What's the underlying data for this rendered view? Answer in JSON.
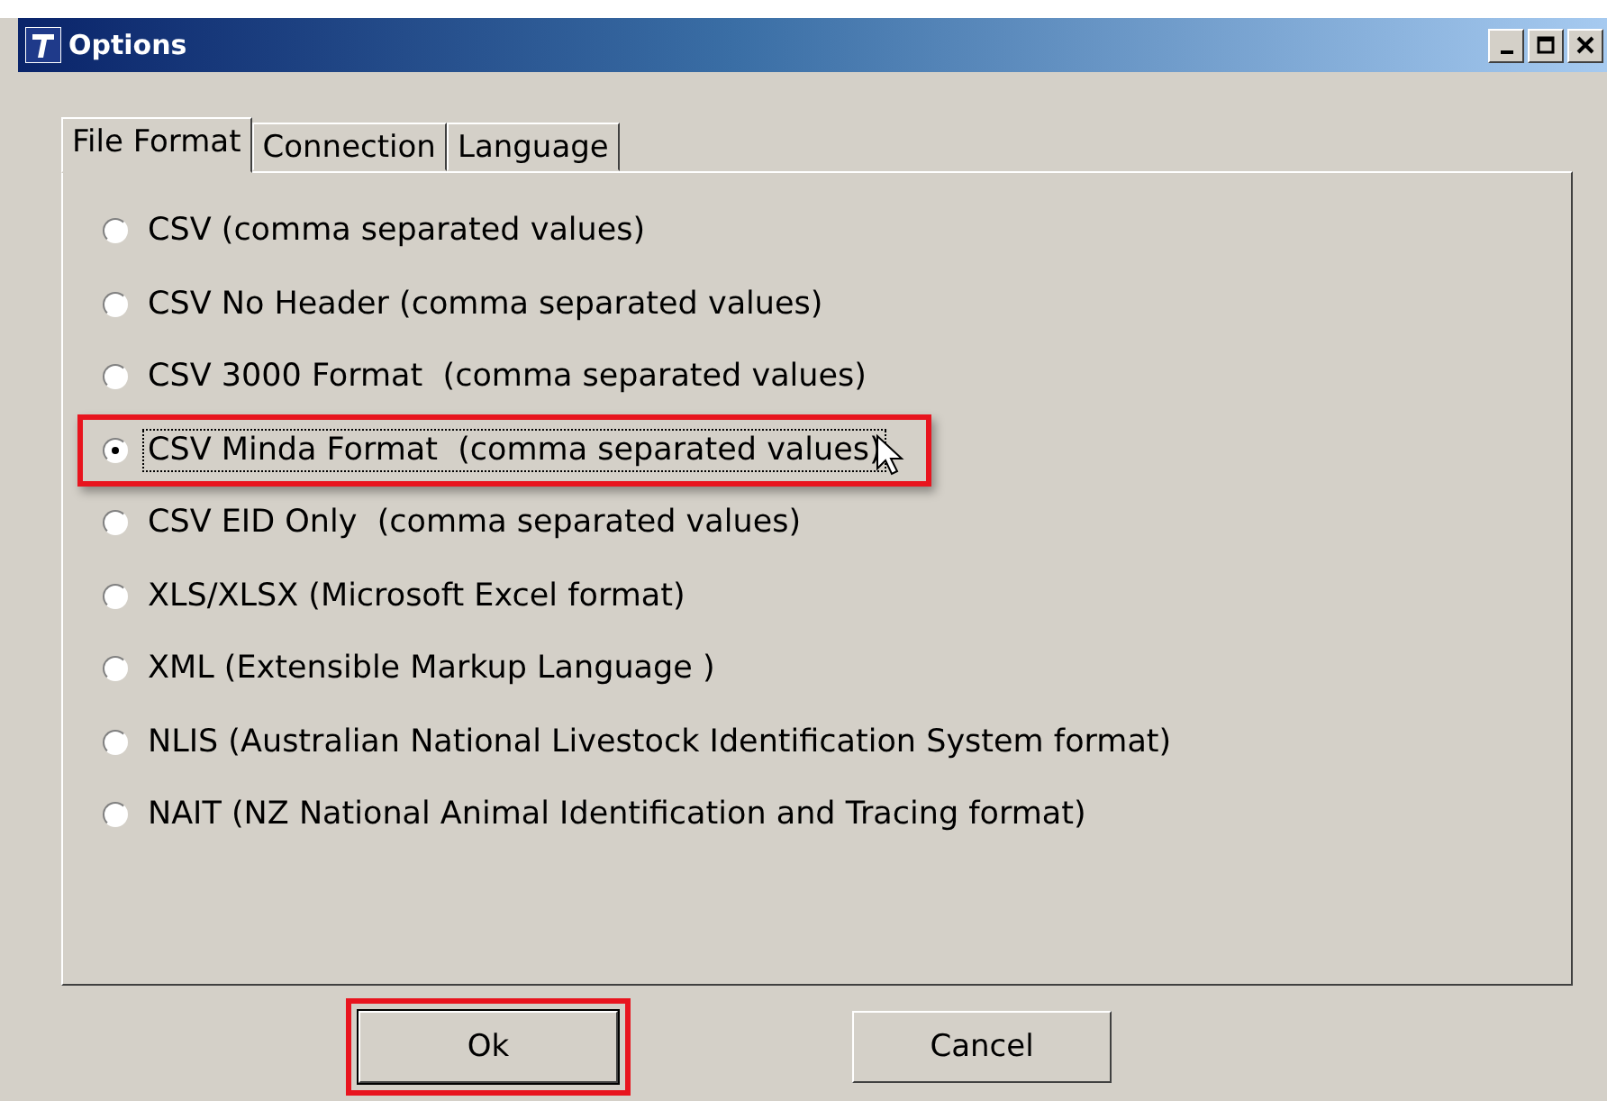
{
  "window": {
    "title": "Options"
  },
  "tabs": [
    {
      "label": "File Format",
      "selected": true
    },
    {
      "label": "Connection",
      "selected": false
    },
    {
      "label": "Language",
      "selected": false
    }
  ],
  "options": [
    {
      "label": "CSV (comma separated values)",
      "selected": false,
      "highlighted": false
    },
    {
      "label": "CSV No Header (comma separated values)",
      "selected": false,
      "highlighted": false
    },
    {
      "label": "CSV 3000 Format  (comma separated values)",
      "selected": false,
      "highlighted": false
    },
    {
      "label": "CSV Minda Format  (comma separated values)",
      "selected": true,
      "highlighted": true
    },
    {
      "label": "CSV EID Only  (comma separated values)",
      "selected": false,
      "highlighted": false
    },
    {
      "label": "XLS/XLSX (Microsoft Excel format)",
      "selected": false,
      "highlighted": false
    },
    {
      "label": "XML (Extensible Markup Language )",
      "selected": false,
      "highlighted": false
    },
    {
      "label": "NLIS (Australian National Livestock Identification System format)",
      "selected": false,
      "highlighted": false
    },
    {
      "label": "NAIT (NZ National Animal Identification and Tracing format)",
      "selected": false,
      "highlighted": false
    }
  ],
  "buttons": [
    {
      "label": "Ok",
      "highlighted": true
    },
    {
      "label": "Cancel",
      "highlighted": false
    }
  ]
}
